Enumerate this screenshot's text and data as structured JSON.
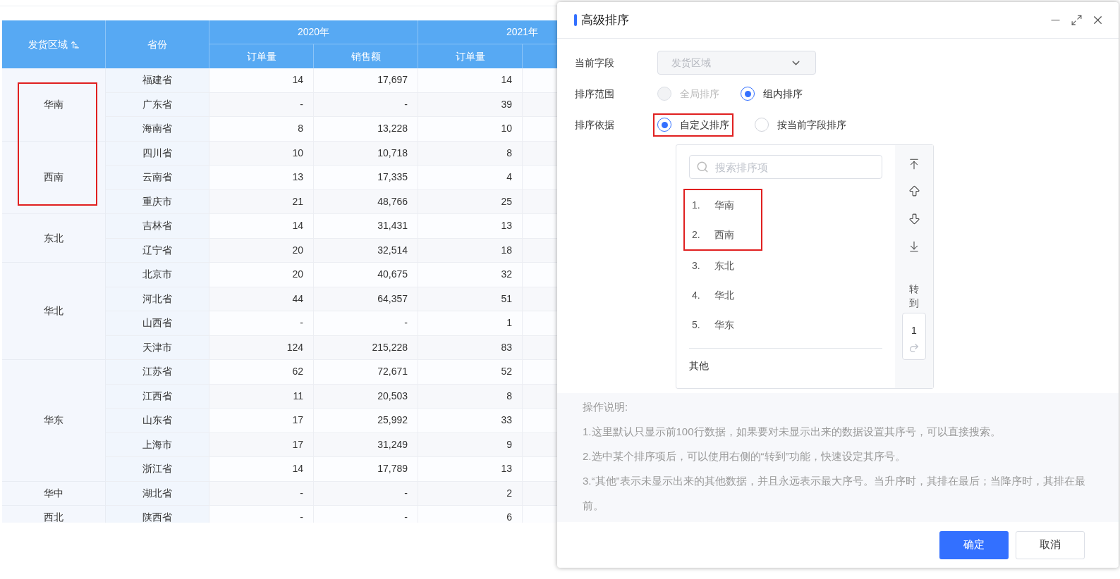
{
  "table": {
    "region_header": "发货区域",
    "province_header": "省份",
    "year_groups": [
      {
        "label": "2020年",
        "columns": [
          "订单量",
          "销售额"
        ]
      },
      {
        "label": "2021年",
        "columns": [
          "订单量"
        ]
      }
    ],
    "regions": [
      {
        "name": "华南",
        "highlighted": true,
        "rows": [
          {
            "province": "福建省",
            "values": [
              "14",
              "17,697",
              "14"
            ]
          },
          {
            "province": "广东省",
            "values": [
              "-",
              "-",
              "39"
            ]
          },
          {
            "province": "海南省",
            "values": [
              "8",
              "13,228",
              "10"
            ]
          }
        ]
      },
      {
        "name": "西南",
        "highlighted": true,
        "rows": [
          {
            "province": "四川省",
            "values": [
              "10",
              "10,718",
              "8"
            ]
          },
          {
            "province": "云南省",
            "values": [
              "13",
              "17,335",
              "4"
            ]
          },
          {
            "province": "重庆市",
            "values": [
              "21",
              "48,766",
              "25"
            ]
          }
        ]
      },
      {
        "name": "东北",
        "highlighted": false,
        "rows": [
          {
            "province": "吉林省",
            "values": [
              "14",
              "31,431",
              "13"
            ]
          },
          {
            "province": "辽宁省",
            "values": [
              "20",
              "32,514",
              "18"
            ]
          }
        ]
      },
      {
        "name": "华北",
        "highlighted": false,
        "rows": [
          {
            "province": "北京市",
            "values": [
              "20",
              "40,675",
              "32"
            ]
          },
          {
            "province": "河北省",
            "values": [
              "44",
              "64,357",
              "51"
            ]
          },
          {
            "province": "山西省",
            "values": [
              "-",
              "-",
              "1"
            ]
          },
          {
            "province": "天津市",
            "values": [
              "124",
              "215,228",
              "83"
            ]
          }
        ]
      },
      {
        "name": "华东",
        "highlighted": false,
        "rows": [
          {
            "province": "江苏省",
            "values": [
              "62",
              "72,671",
              "52"
            ]
          },
          {
            "province": "江西省",
            "values": [
              "11",
              "20,503",
              "8"
            ]
          },
          {
            "province": "山东省",
            "values": [
              "17",
              "25,992",
              "33"
            ]
          },
          {
            "province": "上海市",
            "values": [
              "17",
              "31,249",
              "9"
            ]
          },
          {
            "province": "浙江省",
            "values": [
              "14",
              "17,789",
              "13"
            ]
          }
        ]
      },
      {
        "name": "华中",
        "highlighted": false,
        "rows": [
          {
            "province": "湖北省",
            "values": [
              "-",
              "-",
              "2"
            ]
          }
        ]
      },
      {
        "name": "西北",
        "highlighted": false,
        "rows": [
          {
            "province": "陕西省",
            "values": [
              "-",
              "-",
              "6"
            ]
          }
        ]
      }
    ]
  },
  "dialog": {
    "title": "高级排序",
    "current_field": {
      "label": "当前字段",
      "value": "发货区域",
      "disabled": true
    },
    "sort_scope": {
      "label": "排序范围",
      "options": [
        {
          "label": "全局排序",
          "selected": false,
          "disabled": true,
          "highlighted": false
        },
        {
          "label": "组内排序",
          "selected": true,
          "disabled": false,
          "highlighted": false
        }
      ]
    },
    "sort_basis": {
      "label": "排序依据",
      "options": [
        {
          "label": "自定义排序",
          "selected": true,
          "disabled": false,
          "highlighted": true
        },
        {
          "label": "按当前字段排序",
          "selected": false,
          "disabled": false,
          "highlighted": false
        }
      ]
    },
    "sort_list": {
      "search": {
        "placeholder": "搜索排序项"
      },
      "items": [
        {
          "index": "1.",
          "label": "华南",
          "highlighted": true
        },
        {
          "index": "2.",
          "label": "西南",
          "highlighted": true
        },
        {
          "index": "3.",
          "label": "东北",
          "highlighted": false
        },
        {
          "index": "4.",
          "label": "华北",
          "highlighted": false
        },
        {
          "index": "5.",
          "label": "华东",
          "highlighted": false
        }
      ],
      "other": "其他",
      "goto_label": "转到",
      "goto_value": "1"
    },
    "notes": {
      "title": "操作说明:",
      "lines": [
        "1.这里默认只显示前100行数据，如果要对未显示出来的数据设置其序号，可以直接搜索。",
        "2.选中某个排序项后，可以使用右侧的“转到”功能，快速设定其序号。",
        "3.“其他”表示未显示出来的其他数据，并且永远表示最大序号。当升序时，其排在最后；当降序时，其排在最前。"
      ]
    },
    "buttons": [
      {
        "label": "确定",
        "kind": "primary"
      },
      {
        "label": "取消",
        "kind": "secondary"
      }
    ]
  }
}
